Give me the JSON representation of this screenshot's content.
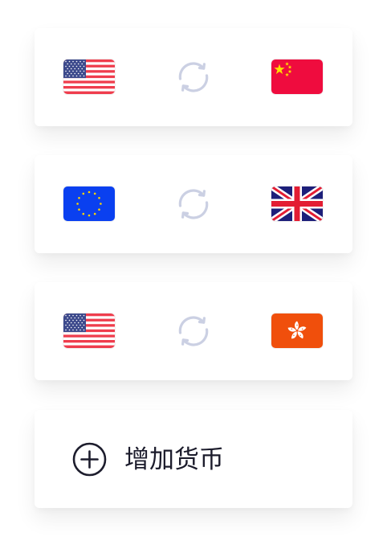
{
  "colors": {
    "swap_icon": "#cbd0e3",
    "add_icon": "#1d1d2d",
    "text": "#1b1b2b"
  },
  "currency_pairs": [
    {
      "from_flag": "flag-us-icon",
      "to_flag": "flag-cn-icon",
      "swap_icon": "swap-icon"
    },
    {
      "from_flag": "flag-eu-icon",
      "to_flag": "flag-gb-icon",
      "swap_icon": "swap-icon"
    },
    {
      "from_flag": "flag-us-icon",
      "to_flag": "flag-hk-icon",
      "swap_icon": "swap-icon"
    }
  ],
  "add_currency": {
    "icon": "plus-circle-icon",
    "label": "增加货币"
  }
}
